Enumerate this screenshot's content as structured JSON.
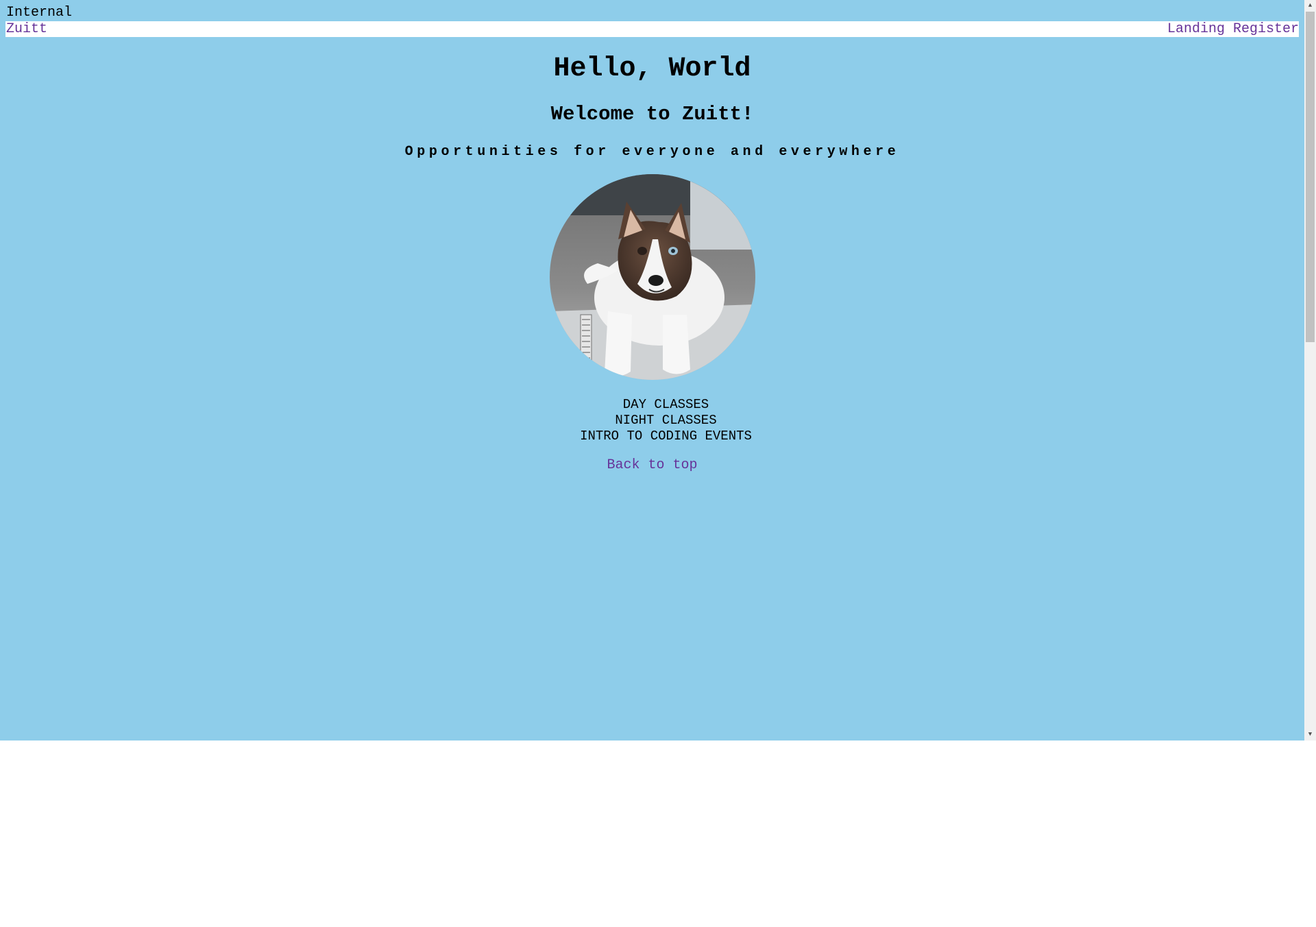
{
  "header": {
    "internal_label": "Internal"
  },
  "navbar": {
    "brand": "Zuitt",
    "links": [
      "Landing",
      "Register"
    ]
  },
  "hero": {
    "title": "Hello, World",
    "subtitle": "Welcome to Zuitt!",
    "tagline": "Opportunities for everyone and everywhere"
  },
  "classes": [
    "DAY CLASSES",
    "NIGHT CLASSES",
    "INTRO TO CODING EVENTS"
  ],
  "footer": {
    "back_to_top": "Back to top"
  },
  "colors": {
    "page_background": "#8ecdea",
    "link": "#663399",
    "navbar_background": "#ffffff"
  },
  "icons": {
    "scroll_up": "triangle-up",
    "scroll_down": "triangle-down"
  }
}
